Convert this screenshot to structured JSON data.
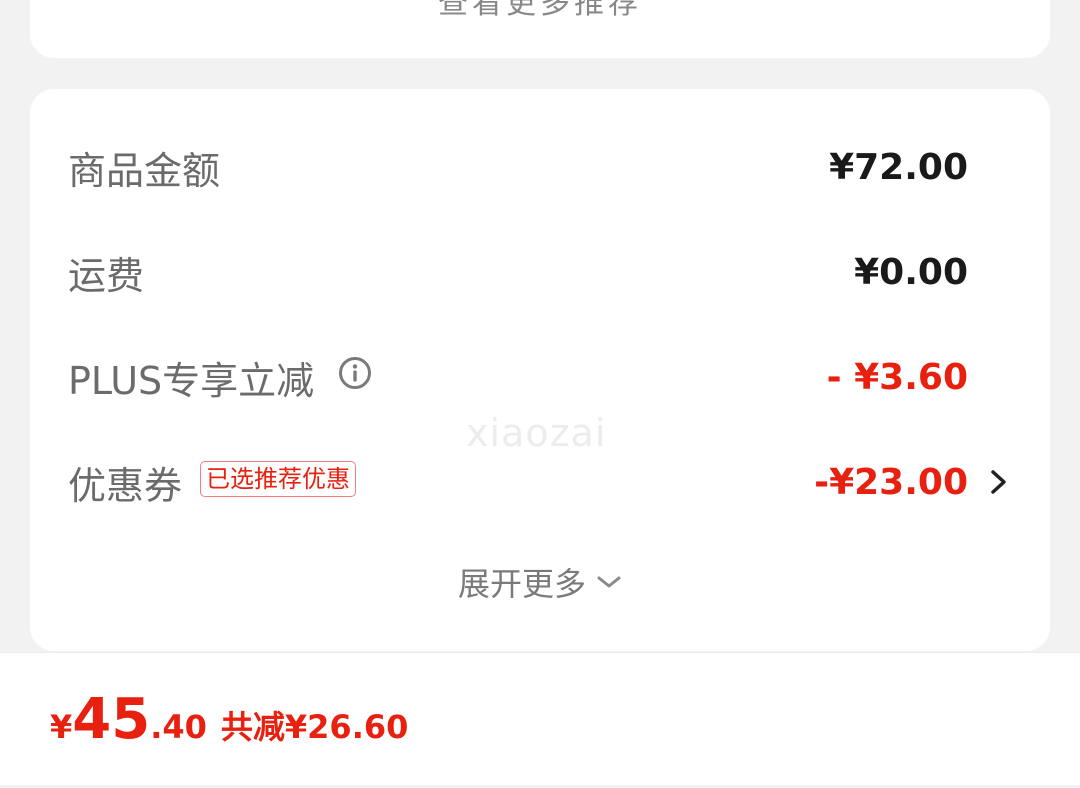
{
  "top_card": {
    "partial_text": "查看更多推荐"
  },
  "summary": {
    "rows": [
      {
        "label": "商品金额",
        "value": "¥72.00"
      },
      {
        "label": "运费",
        "value": "¥0.00"
      },
      {
        "label": "PLUS专享立减",
        "value": "- ¥3.60"
      },
      {
        "label": "优惠券",
        "tag": "已选推荐优惠",
        "value": "-¥23.00"
      }
    ],
    "expand_label": "展开更多",
    "watermark": "xiaozai"
  },
  "bottom_bar": {
    "currency": "¥",
    "total_int": "45",
    "total_dec": ".40",
    "saved_text": "共减¥26.60"
  },
  "colors": {
    "accent_red": "#e8200f",
    "background": "#f2f2f2",
    "card": "#ffffff"
  },
  "icons": [
    "info-icon",
    "chevron-right-icon",
    "chevron-down-icon"
  ]
}
